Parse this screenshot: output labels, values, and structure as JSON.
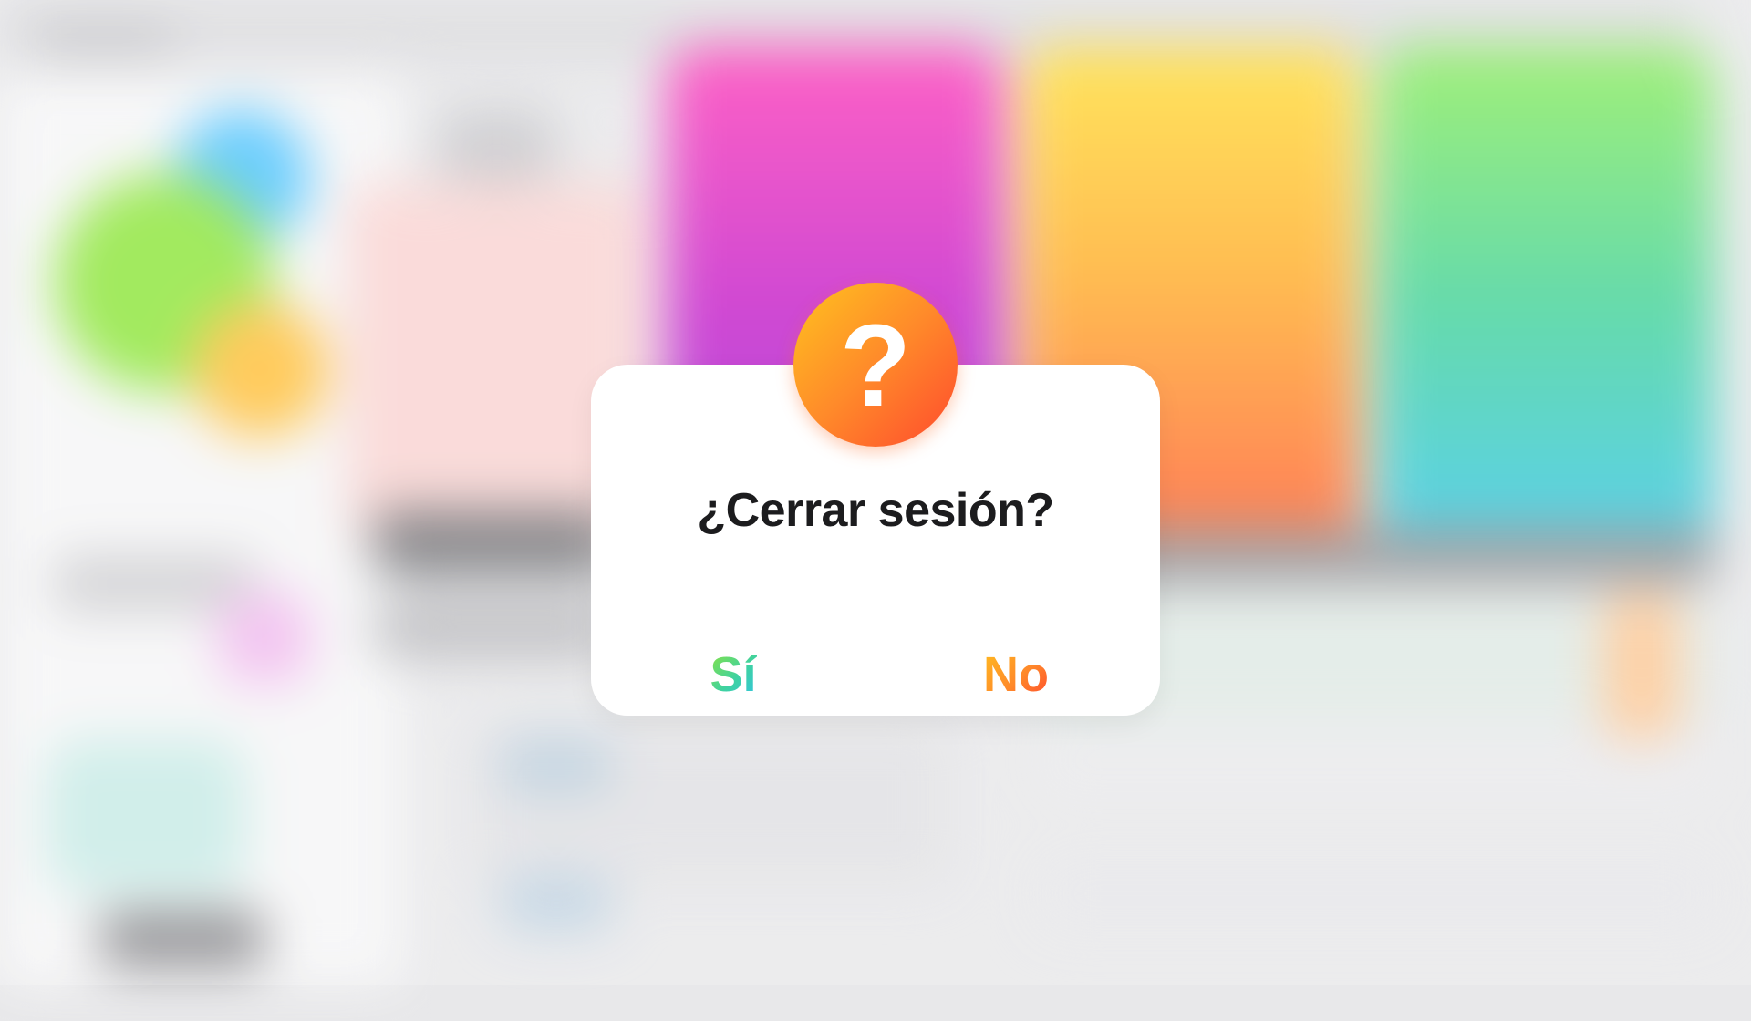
{
  "dialog": {
    "icon": "question-mark-icon",
    "icon_glyph": "?",
    "title": "¿Cerrar sesión?",
    "confirm_label": "Sí",
    "cancel_label": "No"
  },
  "colors": {
    "badge_gradient": [
      "#ffc21f",
      "#ff8a2a",
      "#ff4a2d"
    ],
    "confirm_gradient": [
      "#8fe43c",
      "#3fd2a0",
      "#30c3e6"
    ],
    "cancel_gradient": [
      "#ffbd1f",
      "#ff8a2a",
      "#ff4a2d"
    ],
    "title_color": "#1c1c1e",
    "card_background": "#ffffff"
  }
}
